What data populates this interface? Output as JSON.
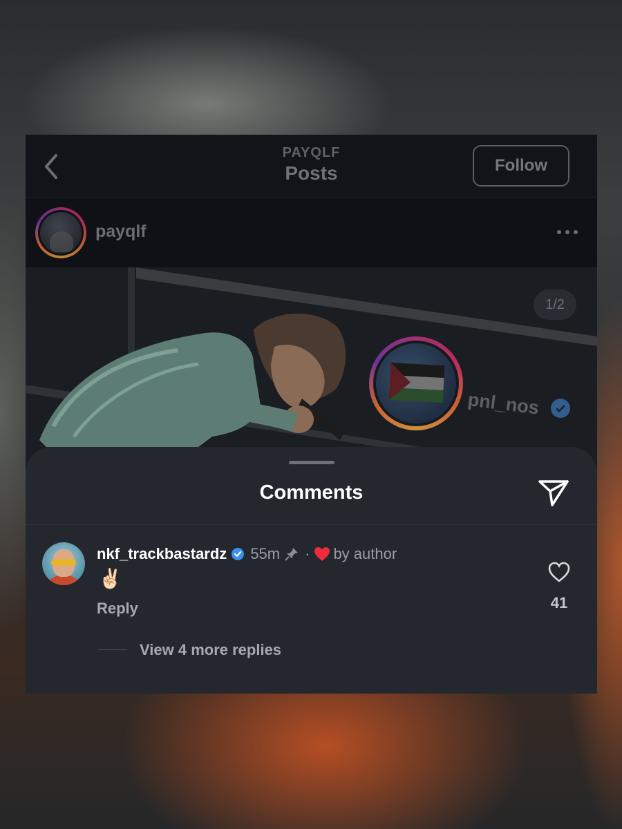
{
  "colors": {
    "background": "#121419",
    "sheet": "#24272e",
    "accent_heart": "#ee2a3d",
    "verified_blue": "#3a8ff0"
  },
  "topbar": {
    "back_icon": "chevron-left-icon",
    "account_label": "PAYQLF",
    "title": "Posts",
    "follow_label": "Follow"
  },
  "post": {
    "username": "payqlf",
    "more_icon": "more-horizontal-icon",
    "page_indicator": "1/2",
    "tagged_username": "pnl_nos"
  },
  "comments_sheet": {
    "title": "Comments",
    "share_icon": "send-icon",
    "comment": {
      "username": "nkf_trackbastardz",
      "time": "55m",
      "separator": "·",
      "liked_by": "by author",
      "text": "✌🏻",
      "reply_label": "Reply",
      "like_count": "41",
      "view_replies": "View 4 more replies"
    }
  }
}
